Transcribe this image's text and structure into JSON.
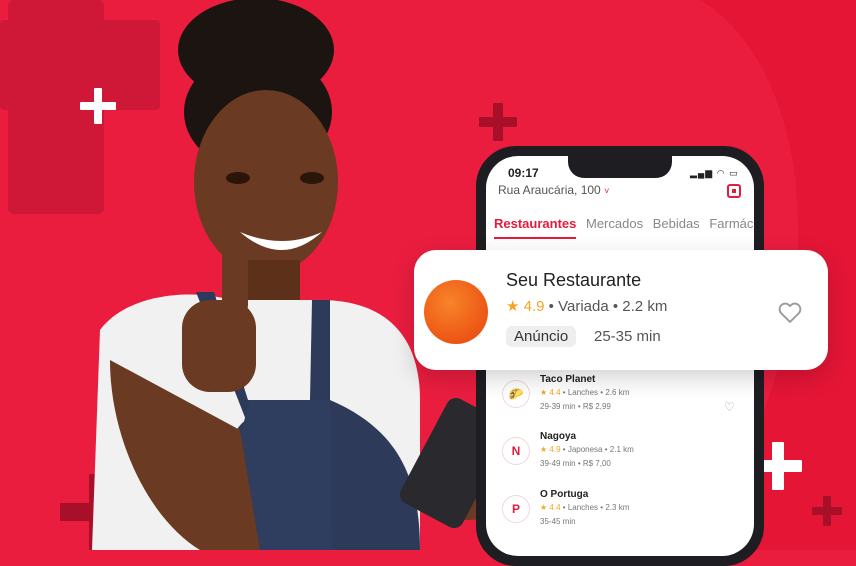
{
  "colors": {
    "brand_red": "#ea1d3f",
    "accent_red": "#e31b3d",
    "star": "#f3a523",
    "logo_orange": "#ec5614"
  },
  "phone": {
    "time": "09:17",
    "address": "Rua Araucária, 100",
    "address_chevron": "˅",
    "tabs": [
      {
        "label": "Restaurantes",
        "active": true
      },
      {
        "label": "Mercados",
        "active": false
      },
      {
        "label": "Bebidas",
        "active": false
      },
      {
        "label": "Farmác",
        "active": false
      }
    ],
    "list": [
      {
        "name": "Taco Planet",
        "rating": "4.4",
        "category": "Lanches",
        "distance": "2.6 km",
        "time": "29-39 min",
        "fee": "R$ 2,99",
        "logo": "taco-logo-icon"
      },
      {
        "name": "Nagoya",
        "rating": "4.9",
        "category": "Japonesa",
        "distance": "2.1 km",
        "time": "39-49 min",
        "fee": "R$ 7,00",
        "logo": "nagoya-logo-icon"
      },
      {
        "name": "O Portuga",
        "rating": "4.4",
        "category": "Lanches",
        "distance": "2.3 km",
        "time": "35-45 min",
        "fee": "",
        "logo": "portuga-logo-icon"
      }
    ]
  },
  "card": {
    "title": "Seu Restaurante",
    "rating": "4.9",
    "category": "Variada",
    "distance": "2.2 km",
    "badge": "Anúncio",
    "time": "25-35 min"
  },
  "separator": "•",
  "icons": {
    "star": "★",
    "heart": "♡"
  }
}
